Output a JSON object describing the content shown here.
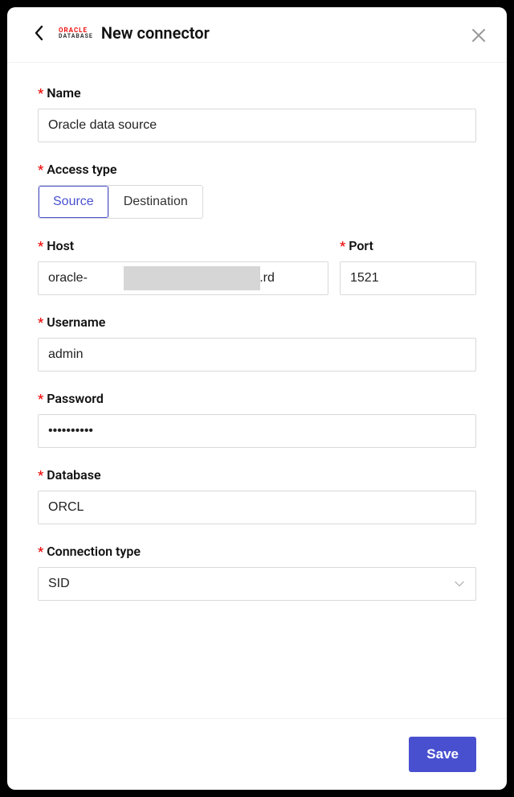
{
  "header": {
    "logo_top": "ORACLE",
    "logo_bottom": "DATABASE",
    "title": "New connector"
  },
  "form": {
    "name": {
      "label": "Name",
      "value": "Oracle data source"
    },
    "access_type": {
      "label": "Access type",
      "opt_source": "Source",
      "opt_destination": "Destination",
      "selected": "Source"
    },
    "host": {
      "label": "Host",
      "value": "oracle-                            .eu-central-1.rd"
    },
    "port": {
      "label": "Port",
      "value": "1521"
    },
    "username": {
      "label": "Username",
      "value": "admin"
    },
    "password": {
      "label": "Password",
      "value": "••••••••••"
    },
    "database": {
      "label": "Database",
      "value": "ORCL"
    },
    "connection_type": {
      "label": "Connection type",
      "value": "SID"
    }
  },
  "footer": {
    "save": "Save"
  }
}
